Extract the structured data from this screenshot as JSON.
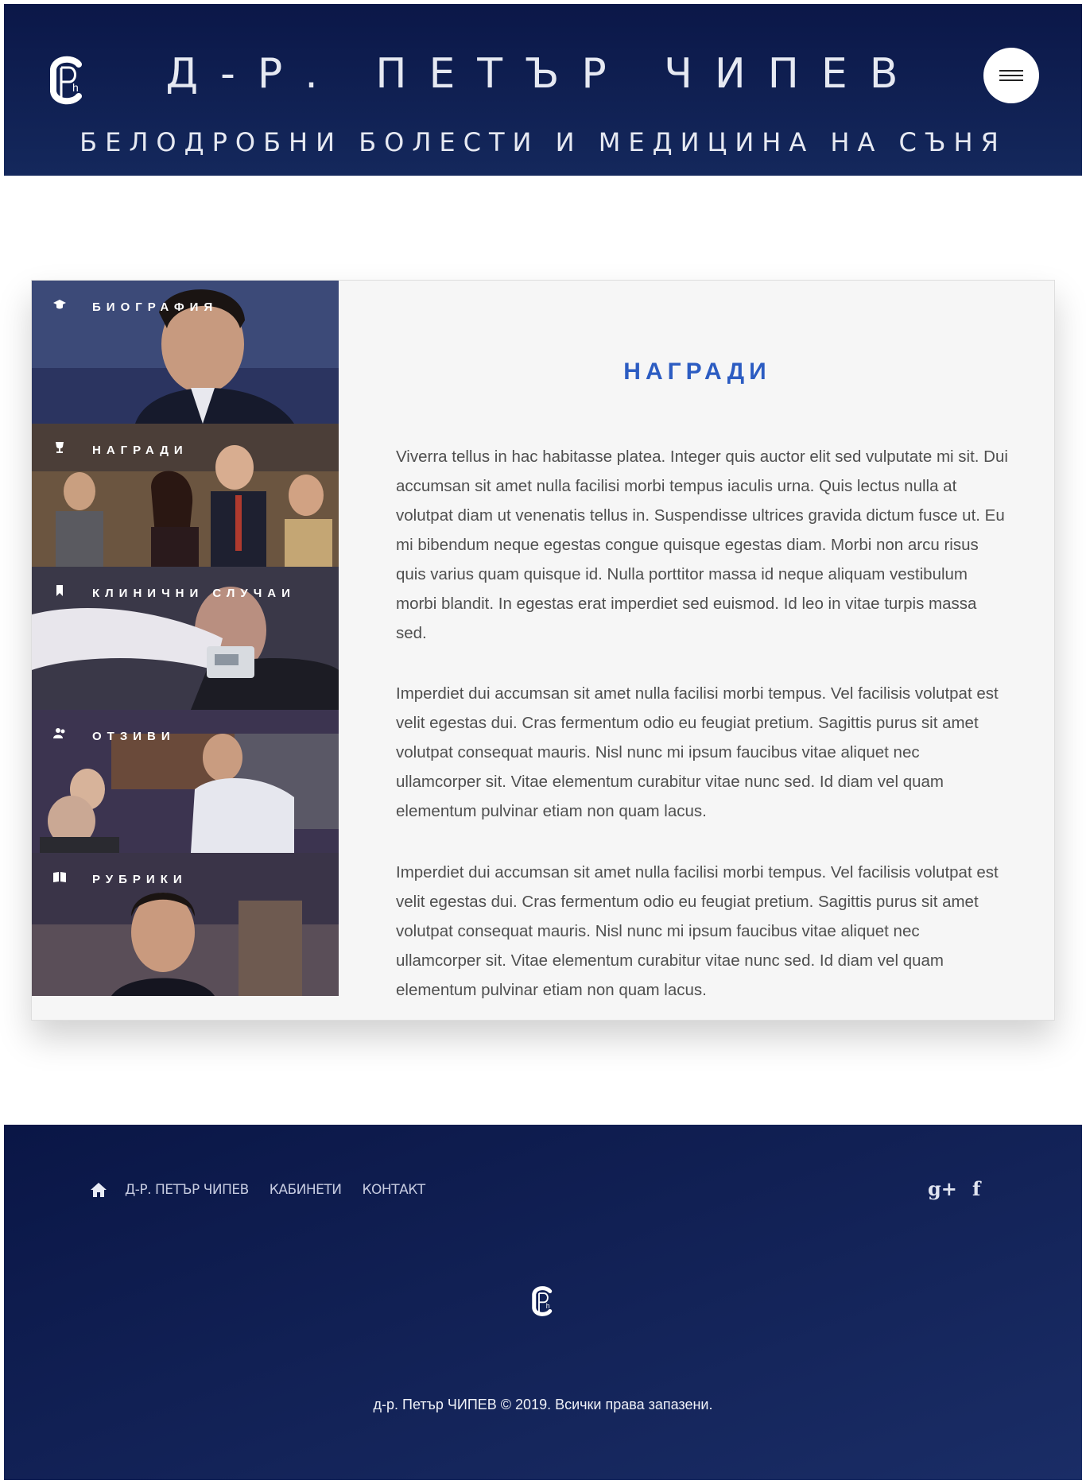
{
  "header": {
    "title": "Д-Р. ПЕТЪР ЧИПЕВ",
    "subtitle": "БЕЛОДРОБНИ БОЛЕСТИ И МЕДИЦИНА НА СЪНЯ",
    "logo_text": "CPh"
  },
  "nav": {
    "items": [
      {
        "label": "БИОГРАФИЯ",
        "icon": "graduation-cap-icon"
      },
      {
        "label": "НАГРАДИ",
        "icon": "trophy-icon"
      },
      {
        "label": "КЛИНИЧНИ СЛУЧАИ",
        "icon": "bookmark-icon"
      },
      {
        "label": "ОТЗИВИ",
        "icon": "users-icon"
      },
      {
        "label": "РУБРИКИ",
        "icon": "book-icon"
      }
    ]
  },
  "content": {
    "title": "НАГРАДИ",
    "paragraphs": [
      "Viverra tellus in hac habitasse platea. Integer quis auctor elit sed vulputate mi sit. Dui accumsan sit amet nulla facilisi morbi tempus iaculis urna. Quis lectus nulla at volutpat diam ut venenatis tellus in. Suspendisse ultrices gravida dictum fusce ut. Eu mi bibendum neque egestas congue quisque egestas diam. Morbi non arcu risus quis varius quam quisque id. Nulla porttitor massa id neque aliquam vestibulum morbi blandit. In egestas erat imperdiet sed euismod. Id leo in vitae turpis massa sed.",
      "Imperdiet dui accumsan sit amet nulla facilisi morbi tempus. Vel facilisis volutpat est velit egestas dui. Cras fermentum odio eu feugiat pretium. Sagittis purus sit amet volutpat consequat mauris. Nisl nunc mi ipsum faucibus vitae aliquet nec ullamcorper sit. Vitae elementum curabitur vitae nunc sed. Id diam vel quam elementum pulvinar etiam non quam lacus.",
      "Imperdiet dui accumsan sit amet nulla facilisi morbi tempus. Vel facilisis volutpat est velit egestas dui. Cras fermentum odio eu feugiat pretium. Sagittis purus sit amet volutpat consequat mauris. Nisl nunc mi ipsum faucibus vitae aliquet nec ullamcorper sit. Vitae elementum curabitur vitae nunc sed. Id diam vel quam elementum pulvinar etiam non quam lacus."
    ]
  },
  "footer": {
    "links": [
      "Д-Р. ПЕТЪР ЧИПЕВ",
      "КАБИНЕТИ",
      "КОНТАКТ"
    ],
    "social": {
      "gplus": "g+",
      "facebook": "f"
    },
    "copyright": "д-р. Петър ЧИПЕВ © 2019. Всички права запазени."
  },
  "colors": {
    "header_bg": "#0b1748",
    "accent_title": "#2c5cc2",
    "footer_bg": "#12245a"
  }
}
